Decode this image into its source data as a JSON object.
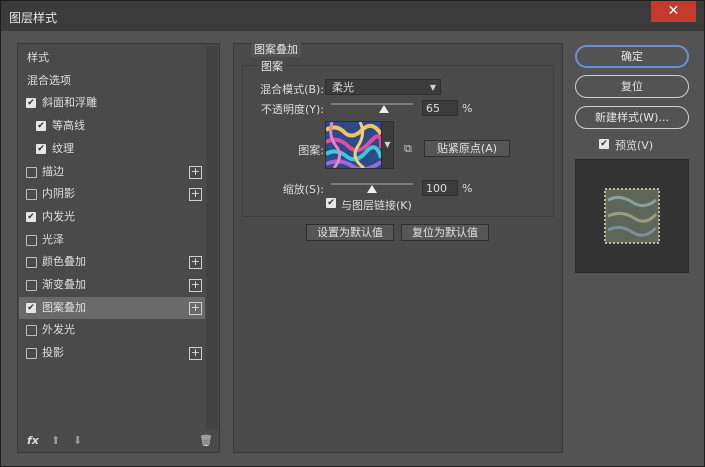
{
  "window": {
    "title": "图层样式",
    "close_glyph": "✕"
  },
  "styles_list": {
    "items": [
      {
        "label": "样式",
        "checkbox": "none",
        "plus": false,
        "selected": false
      },
      {
        "label": "混合选项",
        "checkbox": "none",
        "plus": false,
        "selected": false
      },
      {
        "label": "斜面和浮雕",
        "checkbox": "checked",
        "plus": false,
        "selected": false
      },
      {
        "label": "等高线",
        "checkbox": "checked",
        "plus": false,
        "selected": false,
        "indent": true
      },
      {
        "label": "纹理",
        "checkbox": "checked",
        "plus": false,
        "selected": false,
        "indent": true
      },
      {
        "label": "描边",
        "checkbox": "unchecked",
        "plus": true,
        "selected": false
      },
      {
        "label": "内阴影",
        "checkbox": "unchecked",
        "plus": true,
        "selected": false
      },
      {
        "label": "内发光",
        "checkbox": "checked",
        "plus": false,
        "selected": false
      },
      {
        "label": "光泽",
        "checkbox": "unchecked",
        "plus": false,
        "selected": false
      },
      {
        "label": "颜色叠加",
        "checkbox": "unchecked",
        "plus": true,
        "selected": false
      },
      {
        "label": "渐变叠加",
        "checkbox": "unchecked",
        "plus": true,
        "selected": false
      },
      {
        "label": "图案叠加",
        "checkbox": "checked",
        "plus": true,
        "selected": true
      },
      {
        "label": "外发光",
        "checkbox": "unchecked",
        "plus": false,
        "selected": false
      },
      {
        "label": "投影",
        "checkbox": "unchecked",
        "plus": true,
        "selected": false
      }
    ],
    "bottom": {
      "fx": "fx",
      "up_icon": "arrow-up-icon",
      "down_icon": "arrow-down-icon",
      "trash_icon": "trash-icon"
    }
  },
  "pattern_overlay": {
    "section_title": "图案叠加",
    "group_title": "图案",
    "blend_mode_label": "混合模式(B):",
    "blend_mode_value": "柔光",
    "opacity_label": "不透明度(Y):",
    "opacity_value": "65",
    "opacity_level": 0.65,
    "percent": "%",
    "pattern_label": "图案:",
    "snap_button": "贴紧原点(A)",
    "scale_label": "缩放(S):",
    "scale_value": "100",
    "scale_level": 0.5,
    "link_label": "与图层链接(K)",
    "link_checked": true,
    "reset_default_button": "设置为默认值",
    "restore_default_button": "复位为默认值"
  },
  "actions": {
    "ok": "确定",
    "reset": "复位",
    "new_style": "新建样式(W)...",
    "preview_label": "预览(V)",
    "preview_checked": true
  },
  "colors": {
    "accent_border": "#6b8fd6",
    "close_red": "#c43b2e"
  }
}
